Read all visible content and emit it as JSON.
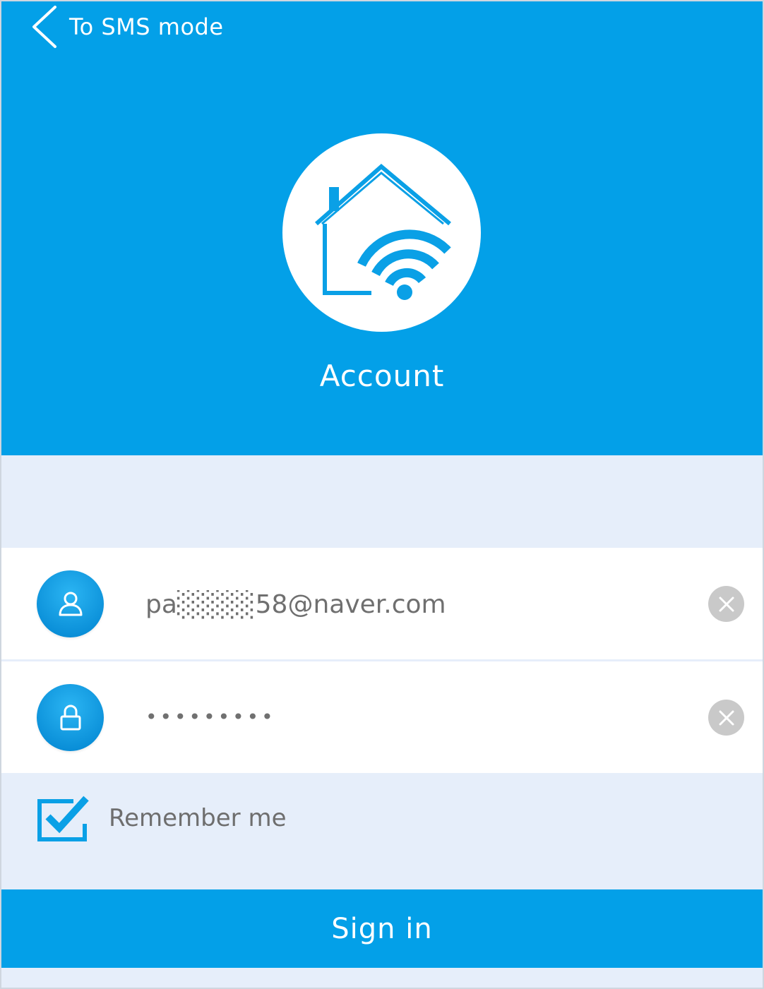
{
  "header": {
    "back_label": "To SMS mode",
    "title": "Account",
    "logo_icon": "home-wifi-icon"
  },
  "form": {
    "email": {
      "value": "pa░░░░58@naver.com",
      "icon": "user-icon",
      "clear_icon": "clear-icon"
    },
    "password": {
      "value": "•••••••••",
      "icon": "lock-icon",
      "clear_icon": "clear-icon"
    },
    "remember": {
      "label": "Remember me",
      "checked": true
    },
    "signin_label": "Sign in"
  },
  "colors": {
    "primary": "#03a0e8",
    "background": "#e6eefa",
    "field_bg": "#ffffff",
    "clear_btn": "#c9c9c9",
    "text_gray": "#6f6f6f"
  }
}
